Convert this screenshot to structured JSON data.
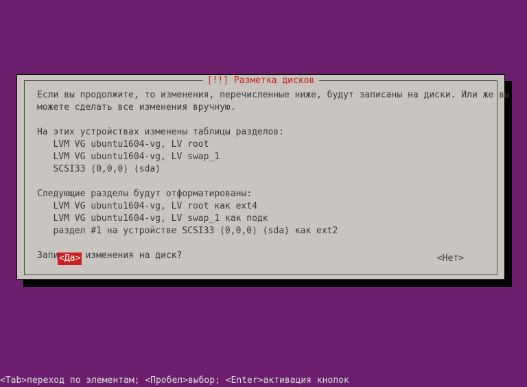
{
  "dialog": {
    "title": "[!!] Разметка дисков",
    "body": "Если вы продолжите, то изменения, перечисленные ниже, будут записаны на диски. Или же вы\nможете сделать все изменения вручную.\n\nНа этих устройствах изменены таблицы разделов:\n   LVM VG ubuntu1604-vg, LV root\n   LVM VG ubuntu1604-vg, LV swap_1\n   SCSI33 (0,0,0) (sda)\n\nСледующие разделы будут отформатированы:\n   LVM VG ubuntu1604-vg, LV root как ext4\n   LVM VG ubuntu1604-vg, LV swap_1 как подк\n   раздел #1 на устройстве SCSI33 (0,0,0) (sda) как ext2\n\nЗаписать изменения на диск?",
    "yes_label": "<Да>",
    "no_label": "<Нет>"
  },
  "help": {
    "text": "<Tab>переход по элементам; <Пробел>выбор; <Enter>активация кнопок"
  }
}
